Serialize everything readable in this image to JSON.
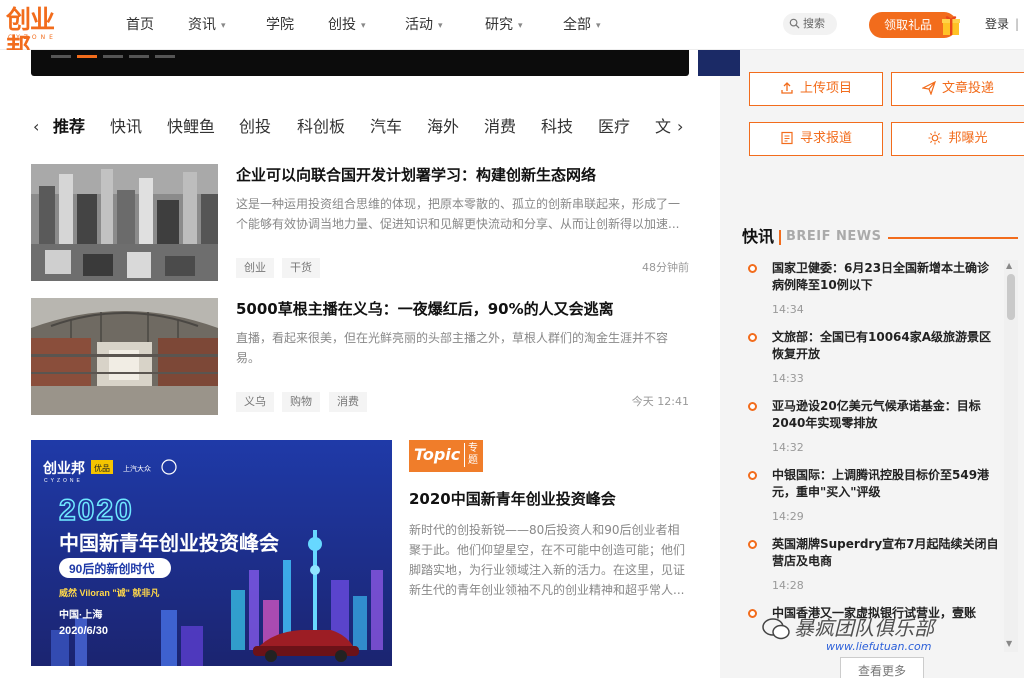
{
  "header": {
    "logo_text": "创业邦",
    "logo_sub": "CYZONE",
    "nav": [
      {
        "label": "首页",
        "dropdown": false
      },
      {
        "label": "资讯",
        "dropdown": true
      },
      {
        "label": "学院",
        "dropdown": false
      },
      {
        "label": "创投",
        "dropdown": true
      },
      {
        "label": "活动",
        "dropdown": true
      },
      {
        "label": "研究",
        "dropdown": true
      },
      {
        "label": "全部",
        "dropdown": true
      }
    ],
    "search_label": "搜索",
    "gift_label": "领取礼品",
    "login_label": "登录",
    "login_sep": "|"
  },
  "channels": {
    "items": [
      "推荐",
      "快讯",
      "快鲤鱼",
      "创投",
      "科创板",
      "汽车",
      "海外",
      "消费",
      "科技",
      "医疗",
      "文"
    ],
    "active_index": 0,
    "prev_arrow": "‹",
    "next_arrow": "›"
  },
  "articles": [
    {
      "title": "企业可以向联合国开发计划署学习：构建创新生态网络",
      "desc": "这是一种运用投资组合思维的体现，把原本零散的、孤立的创新串联起来，形成了一个能够有效协调当地力量、促进知识和见解更快流动和分享、从而让创新得以加速...",
      "tags": [
        "创业",
        "干货"
      ],
      "time": "48分钟前",
      "thumb": "city-aerial-image"
    },
    {
      "title": "5000草根主播在义乌：一夜爆红后，90%的人又会逃离",
      "desc": "直播，看起来很美，但在光鲜亮丽的头部主播之外，草根人群们的淘金生涯并不容易。",
      "tags": [
        "义乌",
        "购物",
        "消费"
      ],
      "time": "今天 12:41",
      "thumb": "mall-interior-image"
    }
  ],
  "topic": {
    "badge_word": "Topic",
    "badge_zh": "专题",
    "title": "2020中国新青年创业投资峰会",
    "desc": "新时代的创投新锐——80后投资人和90后创业者相聚于此。他们仰望星空，在不可能中创造可能；他们脚踏实地，为行业领域注入新的活力。在这里，见证新生代的青年创业领袖不凡的创业精神和超乎常人...",
    "banner": {
      "brand": "创业邦",
      "brand_sub": "CYZONE",
      "year": "2020",
      "headline": "中国新青年创业投资峰会",
      "sub_pill": "90后的新创时代",
      "slogan": "威然 Viloran \"诚\" 就非凡",
      "place": "中国·上海",
      "date": "2020/6/30",
      "sponsor1": "优品",
      "sponsor2": "上汽大众"
    }
  },
  "sidebar": {
    "buttons": [
      {
        "label": "上传项目",
        "icon": "upload-icon"
      },
      {
        "label": "文章投递",
        "icon": "paper-plane-icon"
      },
      {
        "label": "寻求报道",
        "icon": "document-icon"
      },
      {
        "label": "邦曝光",
        "icon": "sun-icon"
      }
    ],
    "news_head_zh": "快讯",
    "news_head_en": "BREIF NEWS",
    "news": [
      {
        "title": "国家卫健委：6月23日全国新增本土确诊病例降至10例以下",
        "time": "14:34"
      },
      {
        "title": "文旅部：全国已有10064家A级旅游景区恢复开放",
        "time": "14:33"
      },
      {
        "title": "亚马逊设20亿美元气候承诺基金：目标2040年实现零排放",
        "time": "14:32"
      },
      {
        "title": "中银国际：上调腾讯控股目标价至549港元，重申\"买入\"评级",
        "time": "14:29"
      },
      {
        "title": "英国潮牌Superdry宣布7月起陆续关闭自营店及电商",
        "time": "14:28"
      },
      {
        "title": "中国香港又一家虚拟银行试营业，壹账",
        "time": ""
      }
    ],
    "more_label": "查看更多"
  },
  "watermark": {
    "main": "暴疯团队俱乐部",
    "url": "www.liefutuan.com"
  },
  "colors": {
    "accent": "#f26c1c",
    "topic_badge": "#f07d2a",
    "banner_bg": "#1d2f8f"
  }
}
